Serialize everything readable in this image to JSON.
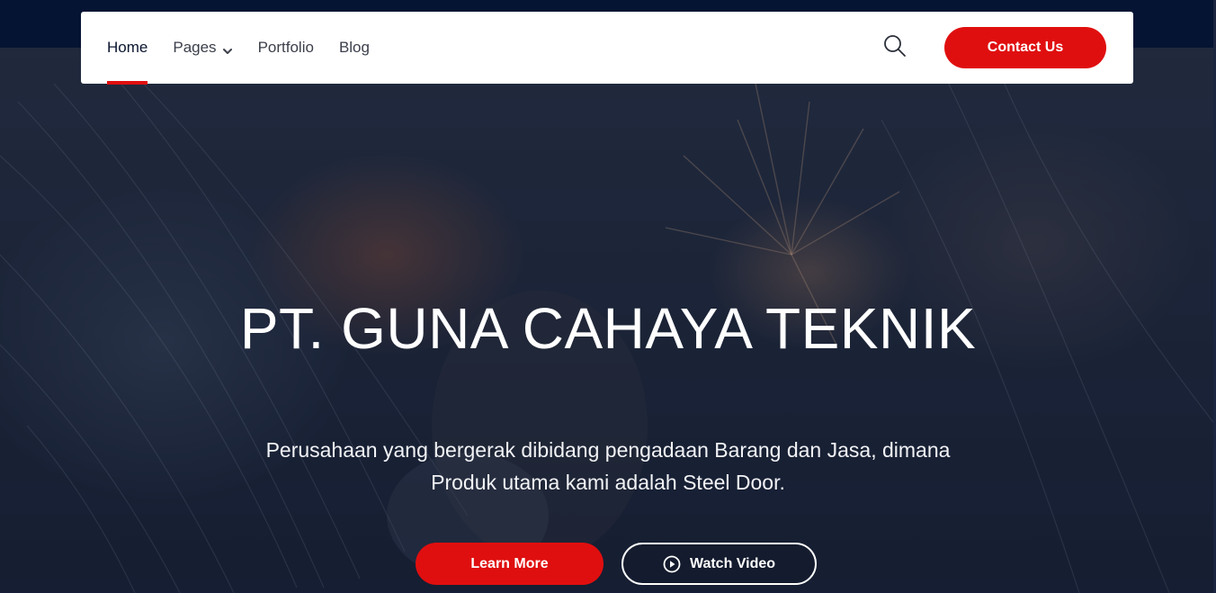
{
  "nav": {
    "items": [
      {
        "label": "Home"
      },
      {
        "label": "Pages"
      },
      {
        "label": "Portfolio"
      },
      {
        "label": "Blog"
      }
    ],
    "contact_label": "Contact Us"
  },
  "hero": {
    "title": "PT. GUNA CAHAYA TEKNIK",
    "subtitle_line1": "Perusahaan yang bergerak dibidang pengadaan Barang dan Jasa, dimana",
    "subtitle_line2": "Produk utama kami adalah Steel Door.",
    "learn_more_label": "Learn More",
    "watch_video_label": "Watch Video"
  },
  "icons": {
    "search": "search-icon",
    "dropdown": "chevron-down-icon",
    "play": "play-circle-icon"
  },
  "colors": {
    "accent": "#e00f0f",
    "topbar": "#061433",
    "nav_text": "#3b3f4a",
    "hero_text": "#ffffff"
  }
}
